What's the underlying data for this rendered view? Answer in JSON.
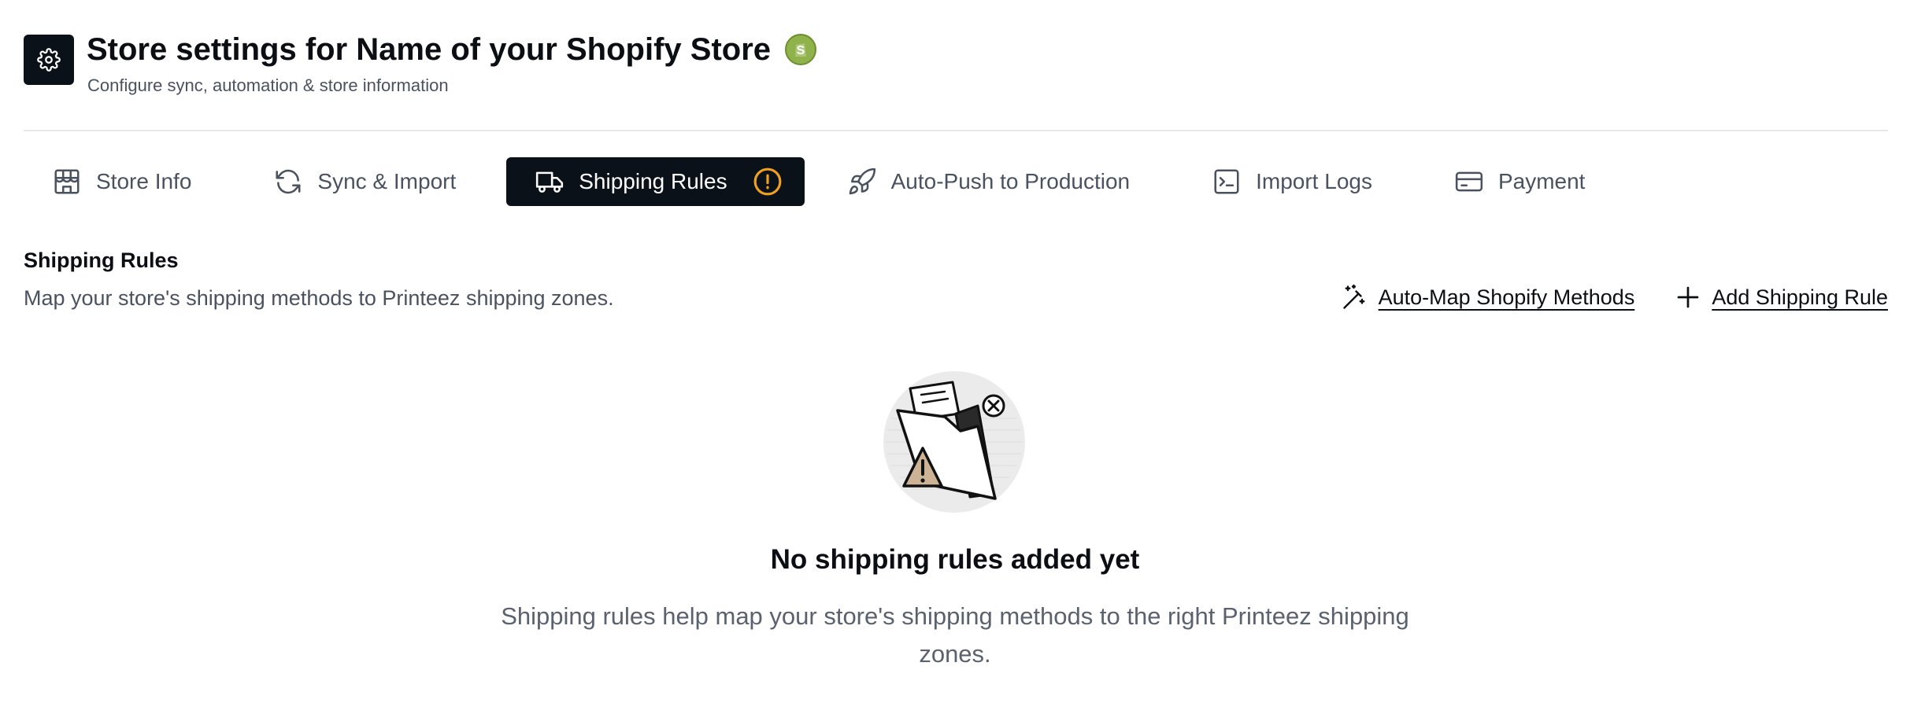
{
  "header": {
    "title": "Store settings for Name of your Shopify Store",
    "subtitle": "Configure sync, automation & store information",
    "icon": "gear-icon",
    "store_logo": "shopify-logo-icon"
  },
  "tabs": [
    {
      "label": "Store Info",
      "icon": "storefront-icon",
      "active": false
    },
    {
      "label": "Sync & Import",
      "icon": "refresh-icon",
      "active": false
    },
    {
      "label": "Shipping Rules",
      "icon": "truck-icon",
      "active": true,
      "badge_icon": "warning-circle-icon"
    },
    {
      "label": "Auto-Push to Production",
      "icon": "rocket-icon",
      "active": false
    },
    {
      "label": "Import Logs",
      "icon": "terminal-icon",
      "active": false
    },
    {
      "label": "Payment",
      "icon": "credit-card-icon",
      "active": false
    }
  ],
  "section": {
    "title": "Shipping Rules",
    "description": "Map your store's shipping methods to Printeez shipping zones."
  },
  "actions": {
    "auto_map": "Auto-Map Shopify Methods",
    "add_rule": "Add Shipping Rule"
  },
  "empty_state": {
    "title": "No shipping rules added yet",
    "description": "Shipping rules help map your store's shipping methods to the right Printeez shipping zones."
  },
  "colors": {
    "dark": "#0b1118",
    "muted_text": "#4a5260",
    "warning": "#f0a020",
    "shopify_green": "#8fb34a"
  }
}
